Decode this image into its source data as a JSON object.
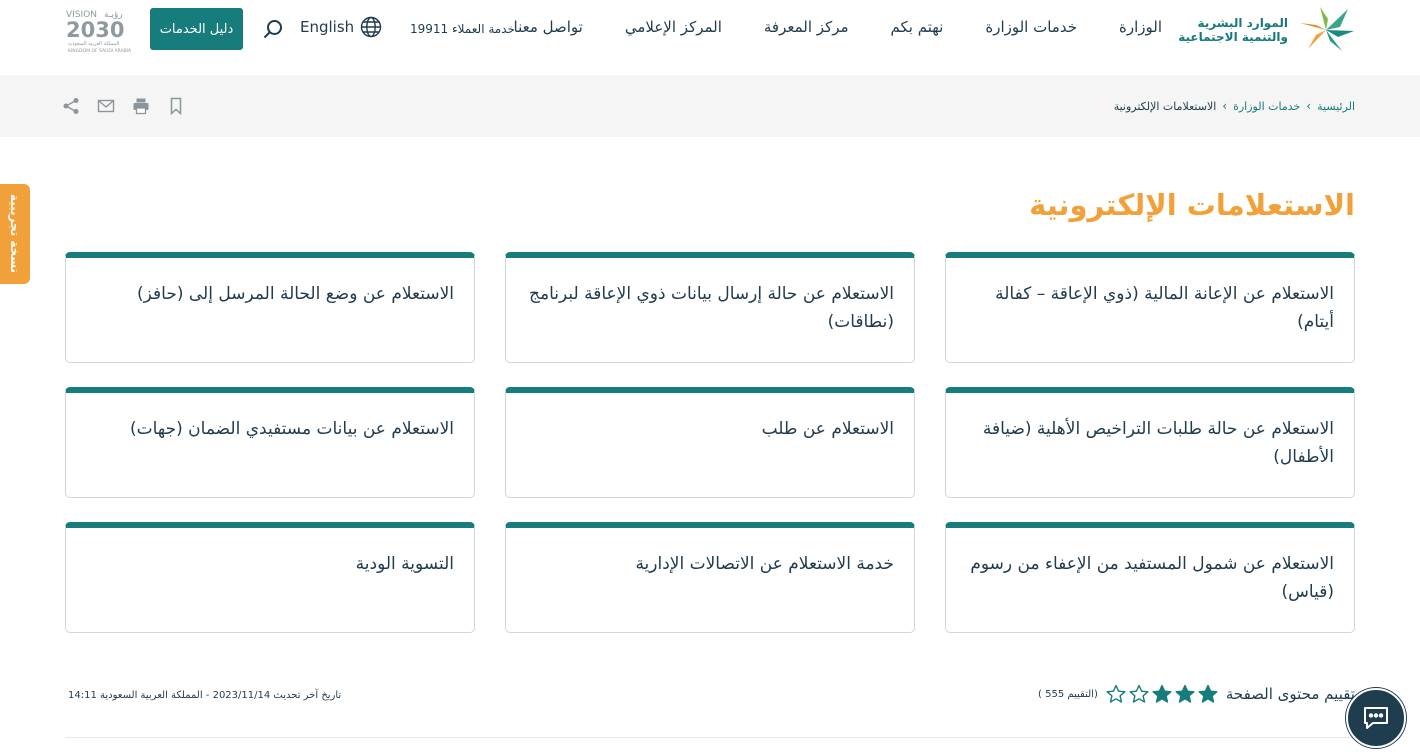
{
  "header": {
    "logo_line1": "الموارد البشرية",
    "logo_line2": "والتنمية الاجتماعية",
    "nav": [
      "الوزارة",
      "خدمات الوزارة",
      "نهتم بكم",
      "مركز المعرفة",
      "المركز الإعلامي",
      "تواصل معنا"
    ],
    "customer_service": "خدمة العملاء 19911",
    "language": "English",
    "guide_button": "دليل الخدمات",
    "vision_text": "VISION",
    "vision_arabic": "رؤيـة",
    "vision_year": "2030",
    "vision_sub": "المملكة العربية السعودية",
    "vision_sub_en": "KINGDOM OF SAUDI ARABIA"
  },
  "breadcrumb": {
    "home": "الرئيسية",
    "services": "خدمات الوزارة",
    "current": "الاستعلامات الإلكترونية",
    "separator": "›"
  },
  "trial_label": "نسخة تجريبية",
  "page_title": "الاستعلامات الإلكترونية",
  "cards": [
    "الاستعلام عن الإعانة المالية (ذوي الإعاقة – كفالة أيتام)",
    "الاستعلام عن حالة إرسال بيانات ذوي الإعاقة لبرنامج (نطاقات)",
    "الاستعلام عن وضع الحالة المرسل إلى (حافز)",
    "الاستعلام عن حالة طلبات التراخيص الأهلية (ضيافة الأطفال)",
    "الاستعلام عن طلب",
    "الاستعلام عن بيانات مستفيدي الضمان (جهات)",
    "الاستعلام عن شمول المستفيد من الإعفاء من رسوم (قياس)",
    "خدمة الاستعلام عن الاتصالات الإدارية",
    "التسوية الودية"
  ],
  "rating": {
    "label": "تقييم محتوى الصفحة",
    "count": "(التقييم 555 )",
    "filled_stars": 3,
    "total_stars": 5
  },
  "last_updated": "تاريخ آخر تحديث 2023/11/14 - المملكة العربية السعودية 14:11",
  "colors": {
    "teal": "#167c7c",
    "orange": "#f2a13a",
    "navy": "#1e3d4f"
  }
}
